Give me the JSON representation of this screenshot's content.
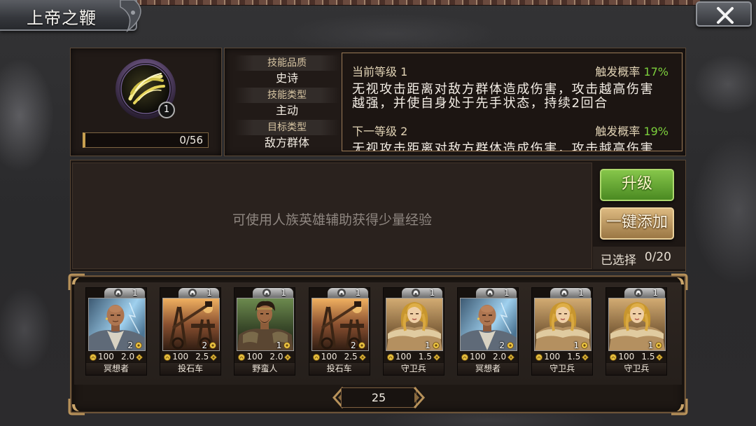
{
  "window": {
    "title": "上帝之鞭",
    "close_icon": "close-icon"
  },
  "skill": {
    "icon": "skill-swirl-icon",
    "level": "1",
    "exp_text": "0/56",
    "exp_progress": 0,
    "attributes": [
      {
        "label": "技能品质",
        "value": "史诗"
      },
      {
        "label": "技能类型",
        "value": "主动"
      },
      {
        "label": "目标类型",
        "value": "敌方群体"
      }
    ],
    "current_level": {
      "title": "当前等级 1",
      "chance_label": "触发概率",
      "chance_value": "17%",
      "description_lines": [
        "无视攻击距离对敌方群体造成伤害，攻击越高伤害",
        "越强，并使自身处于先手状态，持续2回合"
      ]
    },
    "next_level": {
      "title": "下一等级 2",
      "chance_label": "触发概率",
      "chance_value": "19%",
      "description_lines": [
        "无视攻击距离对敌方群体造成伤害，攻击越高伤害"
      ]
    }
  },
  "material": {
    "hint": "可使用人族英雄辅助获得少量经验",
    "upgrade_label": "升级",
    "auto_add_label": "一键添加",
    "selected_label": "已选择",
    "selected_count": "0/20"
  },
  "cards": [
    {
      "name": "冥想者",
      "level": "1",
      "star": "2",
      "cost": "100",
      "power": "2.0",
      "portrait": "monk-portrait"
    },
    {
      "name": "投石车",
      "level": "1",
      "star": "2",
      "cost": "100",
      "power": "2.5",
      "portrait": "catapult-portrait"
    },
    {
      "name": "野蛮人",
      "level": "1",
      "star": "1",
      "cost": "100",
      "power": "2.0",
      "portrait": "barbarian-portrait"
    },
    {
      "name": "投石车",
      "level": "1",
      "star": "2",
      "cost": "100",
      "power": "2.5",
      "portrait": "catapult-portrait"
    },
    {
      "name": "守卫兵",
      "level": "1",
      "star": "1",
      "cost": "100",
      "power": "1.5",
      "portrait": "guard-portrait"
    },
    {
      "name": "冥想者",
      "level": "1",
      "star": "2",
      "cost": "100",
      "power": "2.0",
      "portrait": "monk-portrait"
    },
    {
      "name": "守卫兵",
      "level": "1",
      "star": "1",
      "cost": "100",
      "power": "1.5",
      "portrait": "guard-portrait"
    },
    {
      "name": "守卫兵",
      "level": "1",
      "star": "1",
      "cost": "100",
      "power": "1.5",
      "portrait": "guard-portrait"
    }
  ],
  "pager": {
    "page": "25"
  },
  "colors": {
    "chance_green": "#7ccf3c",
    "upgrade_green": "#5a9a2c",
    "gold": "#b8925a"
  }
}
